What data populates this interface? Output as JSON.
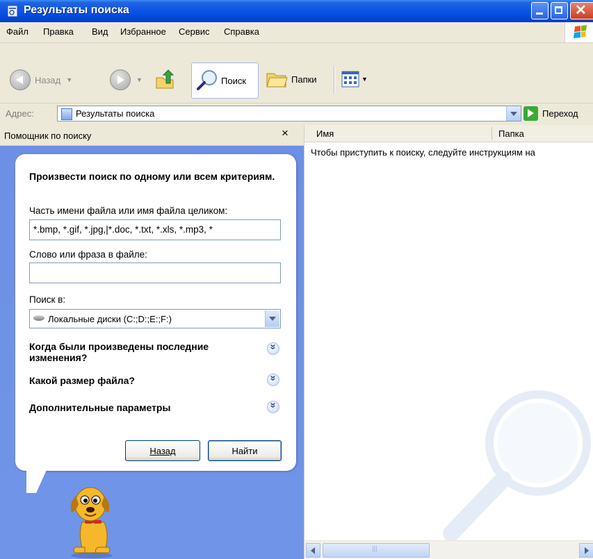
{
  "window": {
    "title": "Результаты поиска"
  },
  "menu": [
    {
      "label": "Файл"
    },
    {
      "label": "Правка"
    },
    {
      "label": "Вид"
    },
    {
      "label": "Избранное"
    },
    {
      "label": "Сервис"
    },
    {
      "label": "Справка"
    }
  ],
  "toolbar": {
    "back_label": "Назад",
    "search_label": "Поиск",
    "folders_label": "Папки"
  },
  "address": {
    "label": "Адрес:",
    "value": "Результаты поиска",
    "go_label": "Переход"
  },
  "search_pane": {
    "header": "Помощник по поиску",
    "close_glyph": "×",
    "prompt": "Произвести поиск по одному или всем критериям.",
    "filename_label": "Часть имени файла или имя файла целиком:",
    "filename_value": "*.bmp, *.gif, *.jpg,|*.doc, *.txt, *.xls, *.mp3, *",
    "phrase_label": "Слово или фраза в файле:",
    "phrase_value": "",
    "lookin_label": "Поиск в:",
    "lookin_value": "Локальные диски (C:;D:;E:;F:)",
    "q_modified": "Когда были произведены последние изменения?",
    "q_size": "Какой размер файла?",
    "q_advanced": "Дополнительные параметры",
    "back_button": "Назад",
    "find_button": "Найти"
  },
  "results": {
    "col_name": "Имя",
    "col_folder": "Папка",
    "message": "Чтобы приступить к поиску, следуйте инструкциям на"
  }
}
